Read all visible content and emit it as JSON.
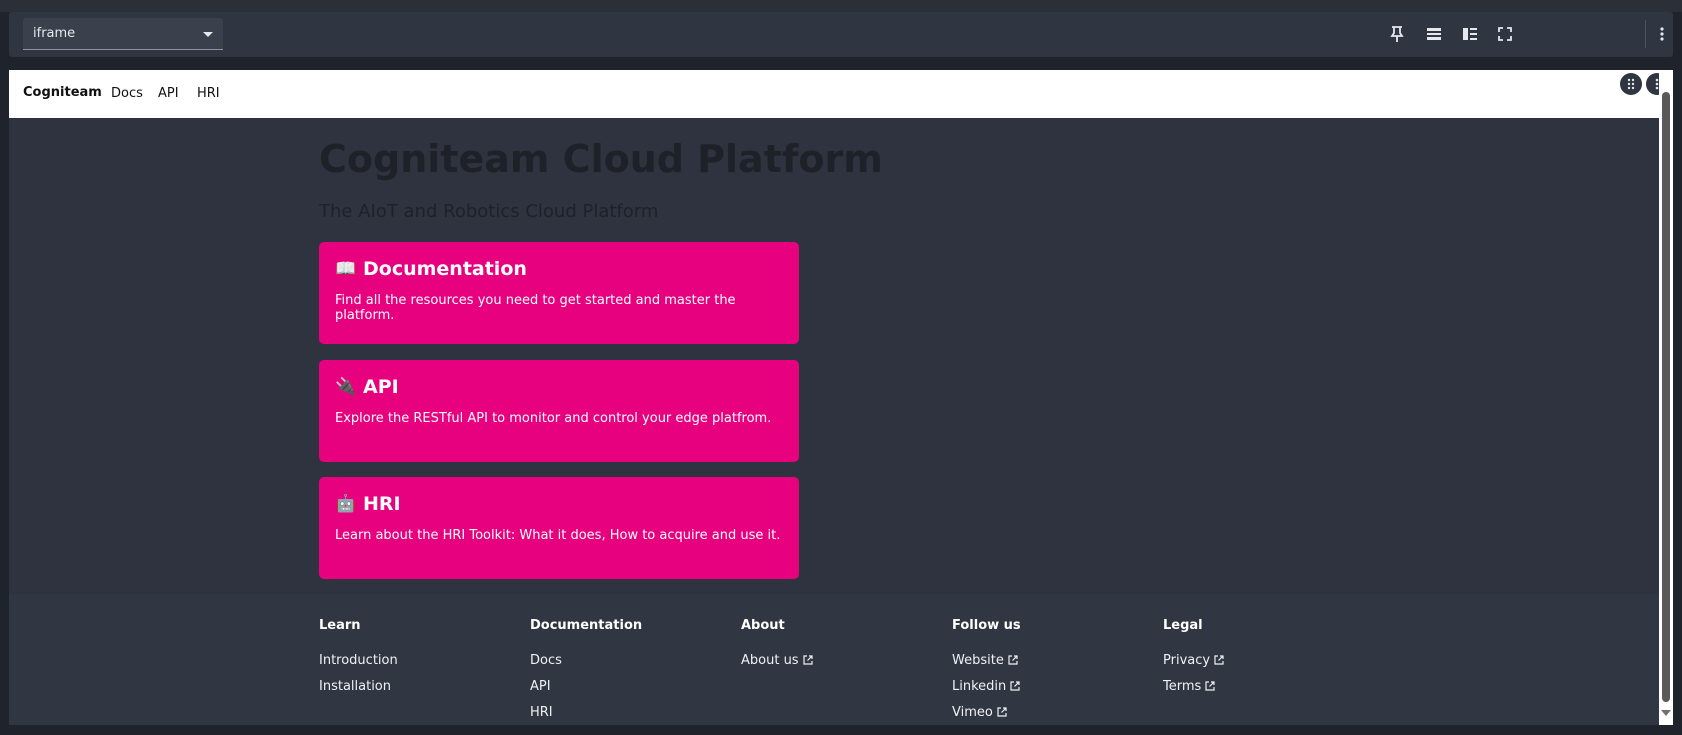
{
  "toolbar": {
    "select_value": "iframe",
    "icons": [
      "pin-icon",
      "layout-rows-icon",
      "layout-sidebar-icon",
      "fullscreen-icon",
      "more-vertical-icon"
    ]
  },
  "navbar": {
    "brand": "Cogniteam",
    "links": [
      "Docs",
      "API",
      "HRI"
    ]
  },
  "hero": {
    "title": "Cogniteam Cloud Platform",
    "subtitle": "The AIoT and Robotics Cloud Platform"
  },
  "cards": [
    {
      "emoji": "📖",
      "title": "Documentation",
      "desc": "Find all the resources you need to get started and master the platform."
    },
    {
      "emoji": "🔌",
      "title": "API",
      "desc": "Explore the RESTful API to monitor and control your edge platfrom."
    },
    {
      "emoji": "🤖",
      "title": "HRI",
      "desc": "Learn about the HRI Toolkit: What it does, How to acquire and use it."
    }
  ],
  "footer": {
    "columns": [
      {
        "title": "Learn",
        "links": [
          "Introduction",
          "Installation"
        ]
      },
      {
        "title": "Documentation",
        "links": [
          "Docs",
          "API",
          "HRI"
        ]
      },
      {
        "title": "About",
        "links": [
          "About us"
        ]
      },
      {
        "title": "Follow us",
        "links": [
          "Website",
          "Linkedin",
          "Vimeo"
        ]
      },
      {
        "title": "Legal",
        "links": [
          "Privacy",
          "Terms"
        ]
      }
    ]
  },
  "colors": {
    "card": "#e8017f",
    "page_bg": "#2e333f",
    "toolbar_bg": "#2f3541"
  }
}
